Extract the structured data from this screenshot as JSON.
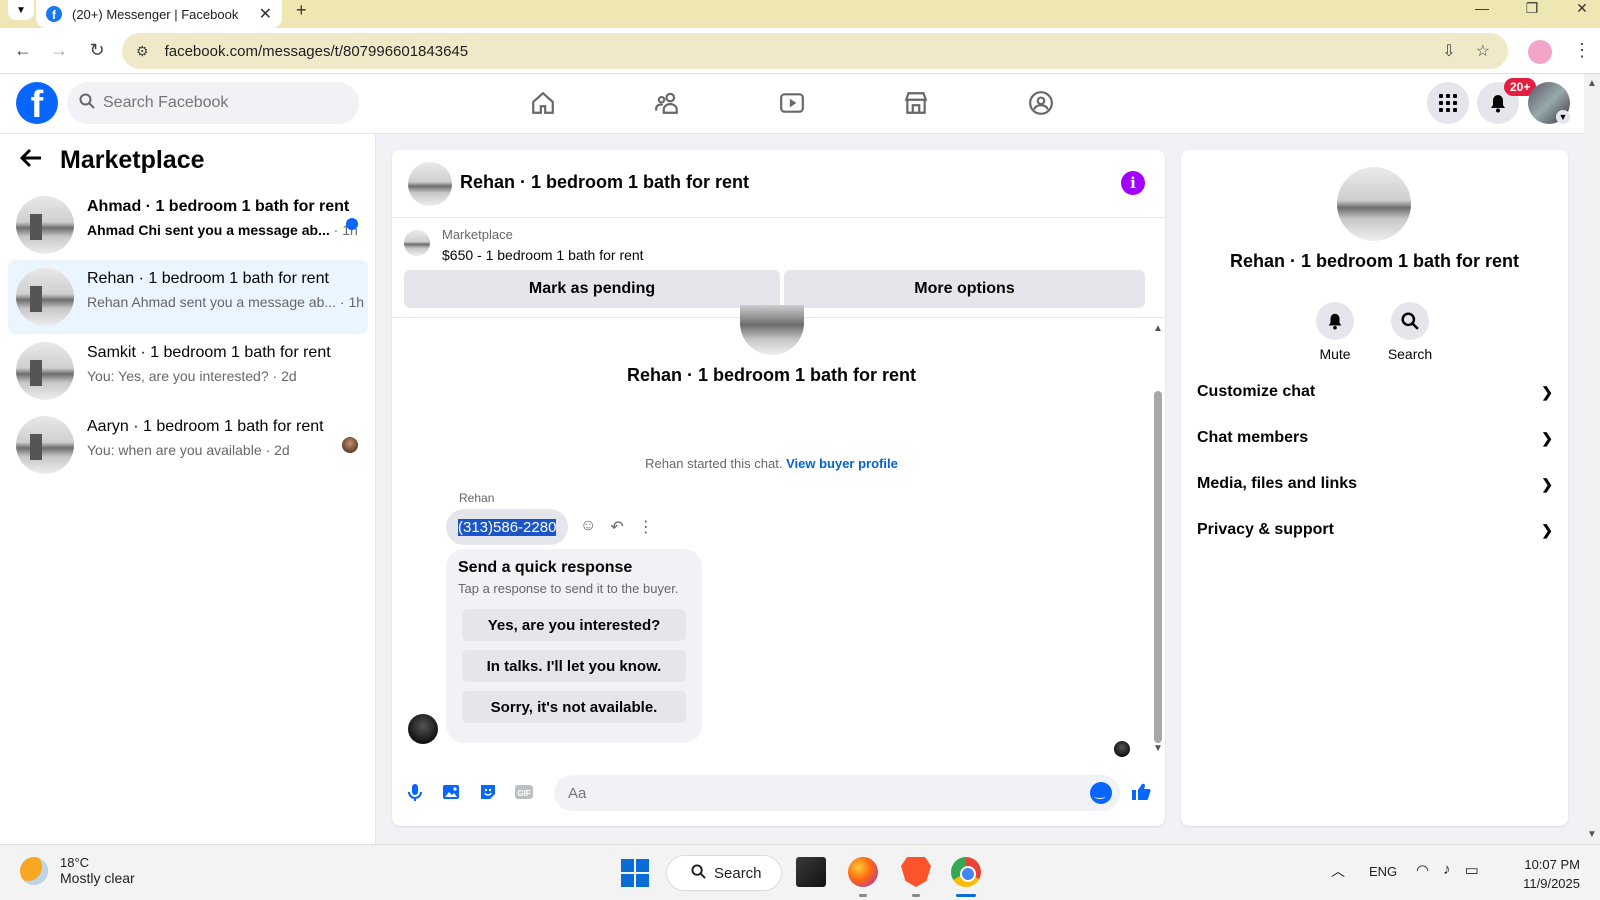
{
  "browser": {
    "tab_title": "(20+) Messenger | Facebook",
    "url": "facebook.com/messages/t/807996601843645"
  },
  "header": {
    "search_placeholder": "Search Facebook",
    "notification_badge": "20+"
  },
  "sidebar": {
    "title": "Marketplace",
    "conversations": [
      {
        "name": "Ahmad · 1 bedroom 1 bath for rent",
        "snippet": "Ahmad Chi sent you a message ab...",
        "time": " · 1h",
        "unread": true
      },
      {
        "name": "Rehan · 1 bedroom 1 bath for rent",
        "snippet": "Rehan Ahmad sent you a message ab...",
        "time": " · 1h",
        "unread": false
      },
      {
        "name": "Samkit · 1 bedroom 1 bath for rent",
        "snippet": "You: Yes, are you interested?",
        "time": " · 2d",
        "unread": false
      },
      {
        "name": "Aaryn · 1 bedroom 1 bath for rent",
        "snippet": "You: when are you available",
        "time": " · 2d",
        "unread": false
      }
    ]
  },
  "chat": {
    "header_title": "Rehan · 1 bedroom 1 bath for rent",
    "marketplace_label": "Marketplace",
    "listing_price": "$650 - 1 bedroom 1 bath for rent",
    "mark_pending": "Mark as pending",
    "more_options": "More options",
    "thread_title": "Rehan · 1 bedroom 1 bath for rent",
    "started_text": "Rehan started this chat.",
    "view_buyer_profile": "View buyer profile",
    "sender_name": "Rehan",
    "message_text": "(313)586-2280",
    "quick_response": {
      "heading": "Send a quick response",
      "subtext": "Tap a response to send it to the buyer.",
      "options": [
        "Yes, are you interested?",
        "In talks. I'll let you know.",
        "Sorry, it's not available."
      ]
    },
    "composer_placeholder": "Aa"
  },
  "details": {
    "title": "Rehan · 1 bedroom 1 bath for rent",
    "mute": "Mute",
    "search": "Search",
    "sections": [
      "Customize chat",
      "Chat members",
      "Media, files and links",
      "Privacy & support"
    ]
  },
  "taskbar": {
    "temperature": "18°C",
    "weather": "Mostly clear",
    "search": "Search",
    "language": "ENG",
    "time": "10:07 PM",
    "date": "11/9/2025"
  },
  "colors": {
    "fb_blue": "#0866ff",
    "active_conv_bg": "#ebf5ff",
    "info_purple": "#a200ff"
  }
}
